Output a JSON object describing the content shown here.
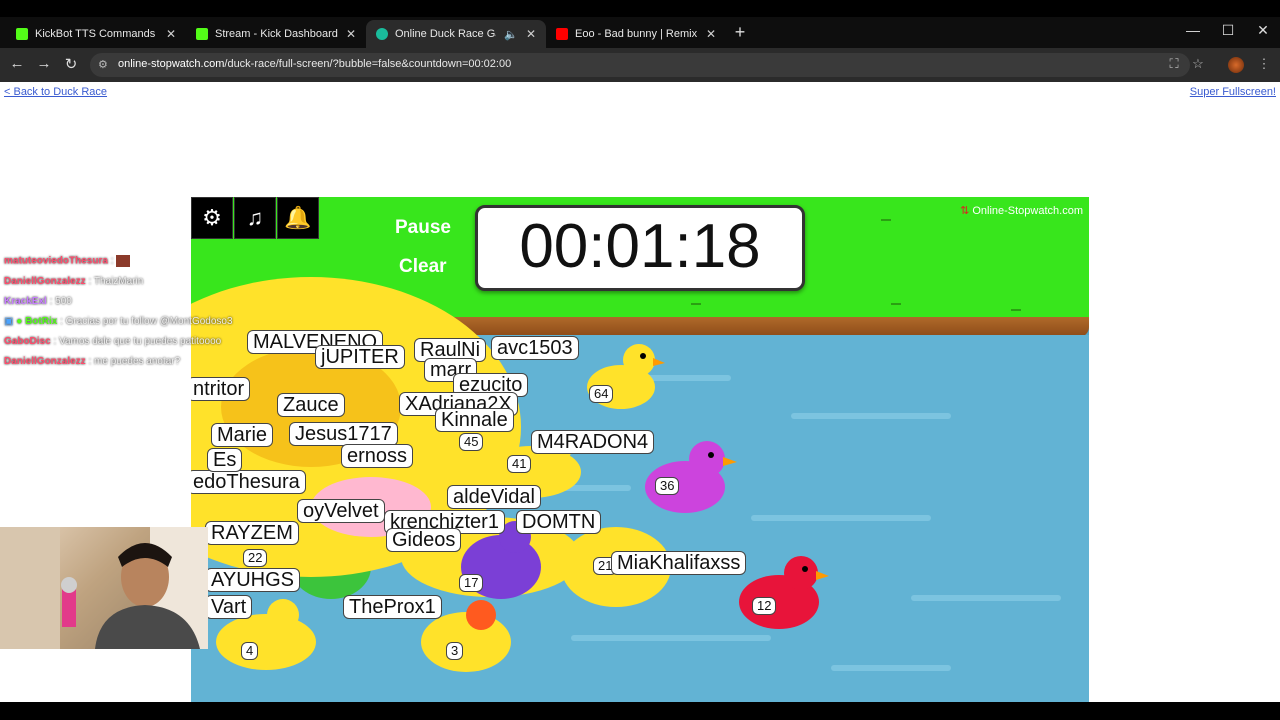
{
  "browser": {
    "tabs": [
      {
        "title": "KickBot TTS Commands",
        "favicon_color": "#53fc18",
        "active": false
      },
      {
        "title": "Stream - Kick Dashboard",
        "favicon_color": "#53fc18",
        "active": false
      },
      {
        "title": "Online Duck Race Game",
        "favicon_color": "#1abc9c",
        "active": true,
        "audio": true
      },
      {
        "title": "Eoo - Bad bunny | Remix intro p",
        "favicon_color": "#ff0000",
        "active": false
      }
    ],
    "url_host": "online-stopwatch.com",
    "url_path": "/duck-race/full-screen/?bubble=false&countdown=00:02:00",
    "icons": {
      "back": "arrow-left-icon",
      "forward": "arrow-right-icon",
      "reload": "reload-icon",
      "translate": "translate-icon",
      "bookmark": "star-icon",
      "menu": "kebab-menu-icon"
    }
  },
  "page": {
    "back_link": "< Back to Duck Race",
    "fullscreen_link": "Super Fullscreen!"
  },
  "game": {
    "pause_label": "Pause",
    "clear_label": "Clear",
    "timer": "00:01:18",
    "brand": "Online-Stopwatch.com",
    "controls": [
      "gear-icon",
      "music-icon",
      "bell-icon"
    ],
    "colors": {
      "grass": "#38e61c",
      "water": "#62b3d4",
      "bank": "#9a5520"
    },
    "name_labels": [
      "MALVENENO",
      "jUPITER",
      "RaulNi",
      "avc1503",
      "marr",
      "Zauce",
      "ezucito",
      "XAdriana2X",
      "Kinnale",
      "Jesus1717",
      "M4RADON4",
      "ernoss",
      "edoThesura",
      "aldeVidal",
      "oyVelvet",
      "krenchizter1",
      "DOMTN",
      "RAYZEM",
      "Gideos",
      "MiaKhalifaxss",
      "AYUHGS",
      "Vart",
      "TheProx1",
      "ntritor",
      "Marie",
      "Es"
    ],
    "duck_numbers": [
      "36",
      "12",
      "41",
      "45",
      "64",
      "22",
      "17",
      "21",
      "4",
      "3"
    ]
  },
  "chat": [
    {
      "user": "matuteoviedoThesura",
      "user_color": "#ff4d6d",
      "message": ""
    },
    {
      "user": "DaniellGonzalezz",
      "user_color": "#ff4d6d",
      "message": "ThaizMarin"
    },
    {
      "user": "KrackExl",
      "user_color": "#c77dff",
      "message": "500"
    },
    {
      "user": "BotRix",
      "user_color": "#53fc18",
      "message": "Gracias por tu follow @MontGodoso3"
    },
    {
      "user": "GaboDisc",
      "user_color": "#ff4d6d",
      "message": "Vamos dale que tu puedes patitoooo"
    },
    {
      "user": "DaniellGonzalezz",
      "user_color": "#ff4d6d",
      "message": "me puedes anotar?"
    }
  ]
}
